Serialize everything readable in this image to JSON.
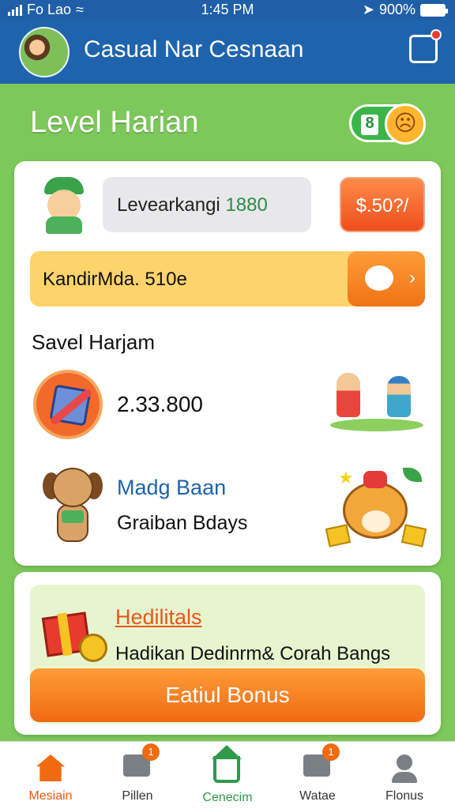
{
  "status": {
    "carrier": "Fo Lao",
    "time": "1:45 PM",
    "battery_text": "900%",
    "battery_level": 1.0
  },
  "header": {
    "title": "Casual Nar Cesnaan"
  },
  "hero": {
    "title": "Level Harian",
    "toggle_value": "8"
  },
  "card": {
    "level_text": "Levearkangi ",
    "level_value": "1880",
    "coin_button": "$.50?/",
    "banner_text": "KandirMda. 510e",
    "section_title": "Savel Harjam",
    "score": "2.33.800",
    "reward_title": "Madg Baan",
    "reward_subtitle": "Graiban Bdays"
  },
  "bonus": {
    "title": "Hedilitals",
    "subtitle": "Hadikan Dedinrm& Corah Bangs",
    "button": "Eatiul Bonus"
  },
  "nav": {
    "items": [
      {
        "label": "Mesiain"
      },
      {
        "label": "Pillen",
        "badge": "1"
      },
      {
        "label": "Cenecim"
      },
      {
        "label": "Watae",
        "badge": "1"
      },
      {
        "label": "Flonus"
      }
    ]
  },
  "colors": {
    "primary_blue": "#1f63ad",
    "background_green": "#7cc85a",
    "accent_orange": "#f06a12"
  }
}
